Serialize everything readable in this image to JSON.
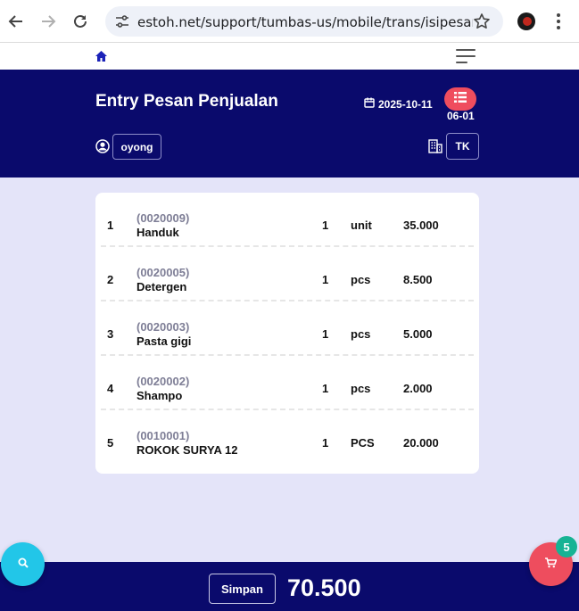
{
  "browser": {
    "url": "estoh.net/support/tumbas-us/mobile/trans/isipesanjual.p..."
  },
  "header": {
    "title": "Entry Pesan Penjualan",
    "date": "2025-10-11",
    "code": "06-01",
    "user": "oyong",
    "store": "TK"
  },
  "items": [
    {
      "no": "1",
      "code": "(0020009)",
      "name": "Handuk",
      "qty": "1",
      "unit": "unit",
      "price": "35.000"
    },
    {
      "no": "2",
      "code": "(0020005)",
      "name": "Detergen",
      "qty": "1",
      "unit": "pcs",
      "price": "8.500"
    },
    {
      "no": "3",
      "code": "(0020003)",
      "name": "Pasta gigi",
      "qty": "1",
      "unit": "pcs",
      "price": "5.000"
    },
    {
      "no": "4",
      "code": "(0020002)",
      "name": "Shampo",
      "qty": "1",
      "unit": "pcs",
      "price": "2.000"
    },
    {
      "no": "5",
      "code": "(0010001)",
      "name": "ROKOK SURYA 12",
      "qty": "1",
      "unit": "PCS",
      "price": "20.000"
    }
  ],
  "footer": {
    "save_label": "Simpan",
    "total": "70.500"
  },
  "cart": {
    "count": "5"
  },
  "colors": {
    "primary": "#0a0a6c",
    "background": "#e4e4f9",
    "accent_red": "#ee4d5e",
    "accent_cyan": "#22c6e8",
    "badge_green": "#17b394"
  },
  "icons": [
    "back-arrow-icon",
    "forward-arrow-icon",
    "reload-icon",
    "site-settings-icon",
    "bookmark-star-icon",
    "browser-menu-icon",
    "home-icon",
    "hamburger-menu-icon",
    "calendar-icon",
    "list-icon",
    "user-circle-icon",
    "building-icon",
    "search-icon",
    "cart-icon"
  ]
}
